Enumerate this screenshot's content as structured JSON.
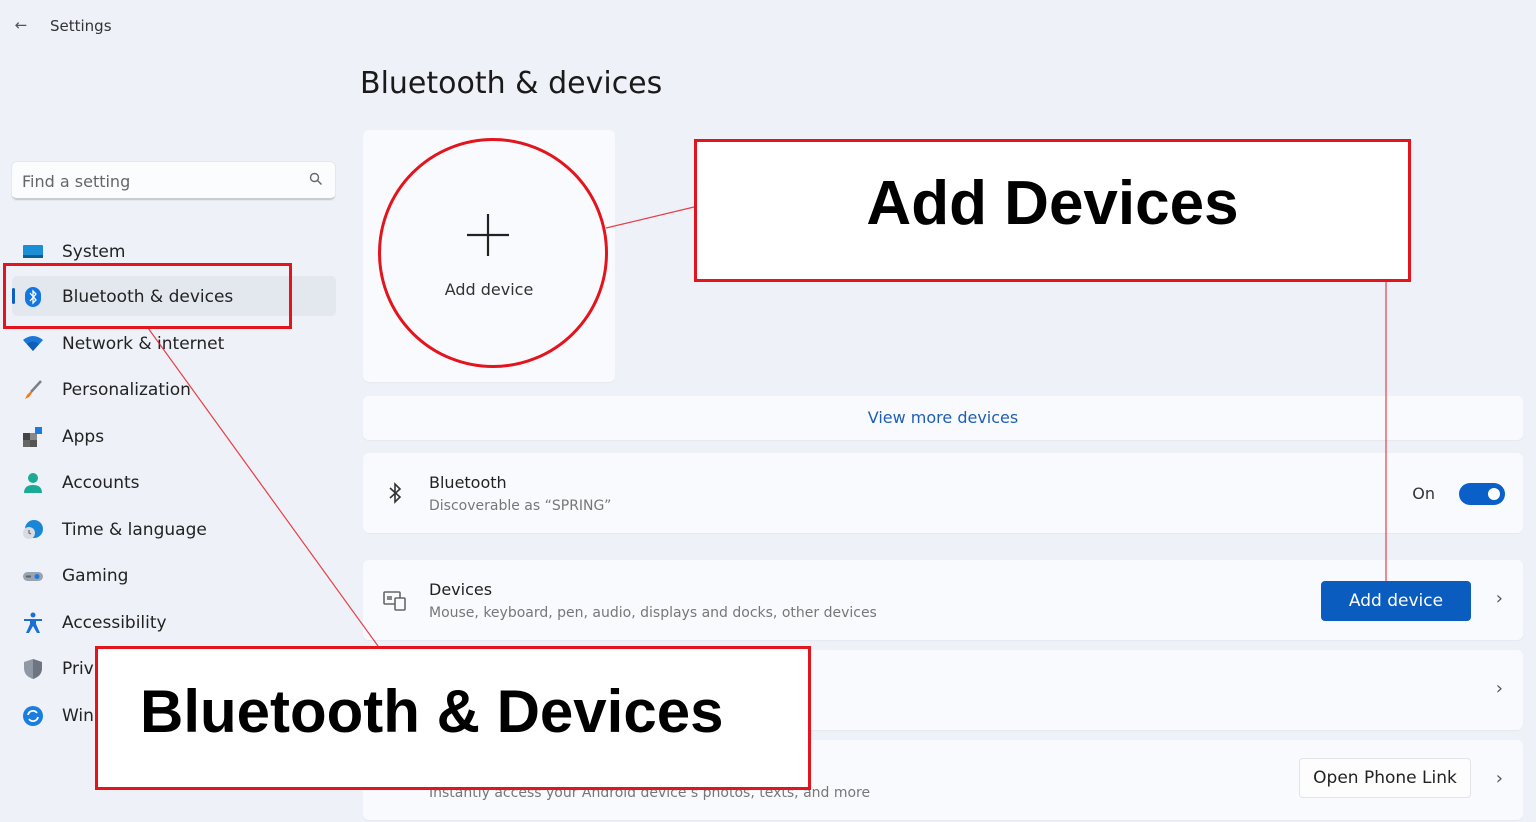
{
  "window": {
    "title": "Settings",
    "back_icon": "back-arrow-icon"
  },
  "search": {
    "placeholder": "Find a setting",
    "value": "",
    "icon": "search-icon"
  },
  "sidebar": {
    "items": [
      {
        "label": "System",
        "icon": "system-icon",
        "active": false
      },
      {
        "label": "Bluetooth & devices",
        "icon": "bluetooth-icon",
        "active": true
      },
      {
        "label": "Network & internet",
        "icon": "wifi-icon",
        "active": false
      },
      {
        "label": "Personalization",
        "icon": "brush-icon",
        "active": false
      },
      {
        "label": "Apps",
        "icon": "apps-icon",
        "active": false
      },
      {
        "label": "Accounts",
        "icon": "account-icon",
        "active": false
      },
      {
        "label": "Time & language",
        "icon": "globe-clock-icon",
        "active": false
      },
      {
        "label": "Gaming",
        "icon": "gamepad-icon",
        "active": false
      },
      {
        "label": "Accessibility",
        "icon": "accessibility-icon",
        "active": false
      },
      {
        "label": "Priv",
        "icon": "shield-icon",
        "active": false
      },
      {
        "label": "Win",
        "icon": "windows-update-icon",
        "active": false
      }
    ]
  },
  "main": {
    "page_title": "Bluetooth & devices",
    "add_device_card": {
      "label": "Add device",
      "icon": "plus-icon"
    },
    "view_more_link": "View more devices",
    "bluetooth_row": {
      "title": "Bluetooth",
      "subtitle": "Discoverable as “SPRING”",
      "toggle_label": "On",
      "toggle_on": true,
      "icon": "bluetooth-icon"
    },
    "devices_row": {
      "title": "Devices",
      "subtitle": "Mouse, keyboard, pen, audio, displays and docks, other devices",
      "button_label": "Add device",
      "icon": "devices-icon",
      "chevron": "›"
    },
    "hidden_row": {
      "chevron": "›"
    },
    "phone_link_row": {
      "subtitle": "Instantly access your Android device’s photos, texts, and more",
      "button_label": "Open Phone Link",
      "chevron": "›"
    }
  },
  "annotations": {
    "add_devices_callout": "Add Devices",
    "bluetooth_devices_callout": "Bluetooth & Devices",
    "highlight_color": "#e3141b"
  },
  "colors": {
    "accent": "#0a5fc8",
    "background": "#eef2f8",
    "card": "#f9fafd",
    "link": "#1f5fb3"
  }
}
